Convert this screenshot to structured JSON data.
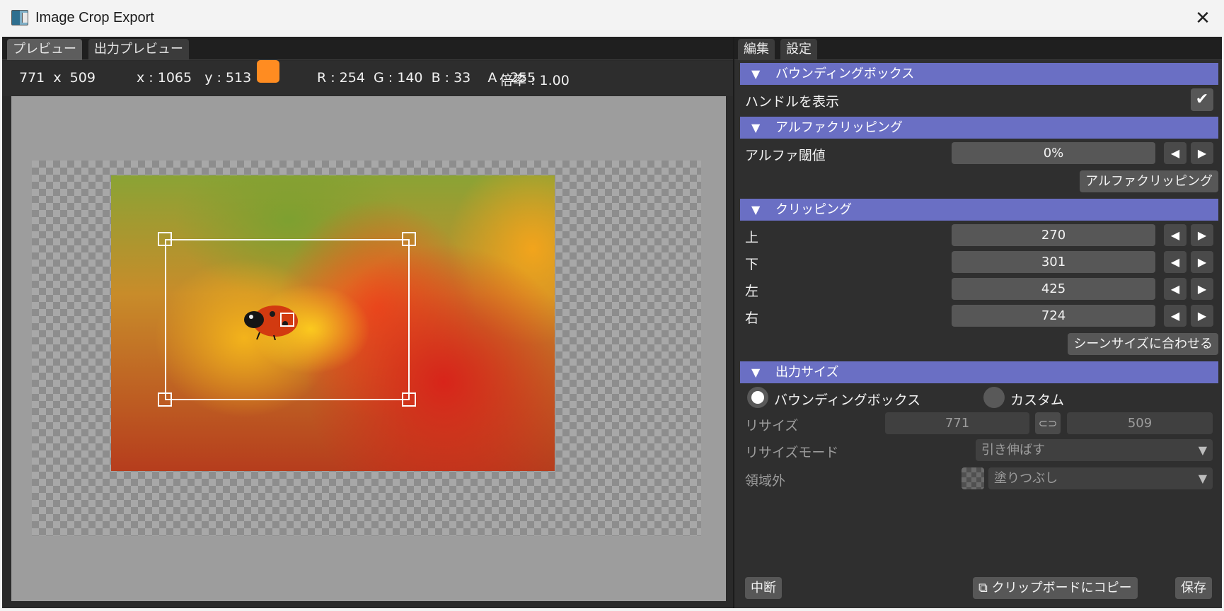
{
  "window": {
    "title": "Image Crop Export",
    "close_glyph": "✕"
  },
  "left": {
    "tabs": [
      "プレビュー",
      "出力プレビュー"
    ],
    "info": {
      "size": "771  x  509",
      "coords": "x : 1065   y : 513",
      "color_swatch": "#ff8c21",
      "rgba": "R : 254  G : 140  B : 33    A : 255",
      "zoom": "倍率 : 1.00"
    }
  },
  "right": {
    "tabs": [
      "編集",
      "設定"
    ],
    "bbox_section": "バウンディングボックス",
    "show_handles": "ハンドルを表示",
    "alpha_section": "アルファクリッピング",
    "alpha_threshold_label": "アルファ閾値",
    "alpha_threshold_value": "0%",
    "alpha_clip_button": "アルファクリッピング",
    "clip_section": "クリッピング",
    "clip_rows": [
      {
        "label": "上",
        "value": "270"
      },
      {
        "label": "下",
        "value": "301"
      },
      {
        "label": "左",
        "value": "425"
      },
      {
        "label": "右",
        "value": "724"
      }
    ],
    "fit_scene_button": "シーンサイズに合わせる",
    "output_section": "出力サイズ",
    "radio_bbox": "バウンディングボックス",
    "radio_custom": "カスタム",
    "resize_label": "リサイズ",
    "resize_w": "771",
    "resize_h": "509",
    "resize_mode_label": "リサイズモード",
    "resize_mode_value": "引き伸ばす",
    "outside_label": "領域外",
    "outside_value": "塗りつぶし",
    "abort_button": "中断",
    "copy_button": "クリップボードにコピー",
    "save_button": "保存"
  },
  "glyphs": {
    "section_triangle": "▼",
    "left": "◀",
    "right": "▶",
    "check": "✔",
    "caret": "▼",
    "link": "⊂⊃",
    "copy": "⧉"
  }
}
